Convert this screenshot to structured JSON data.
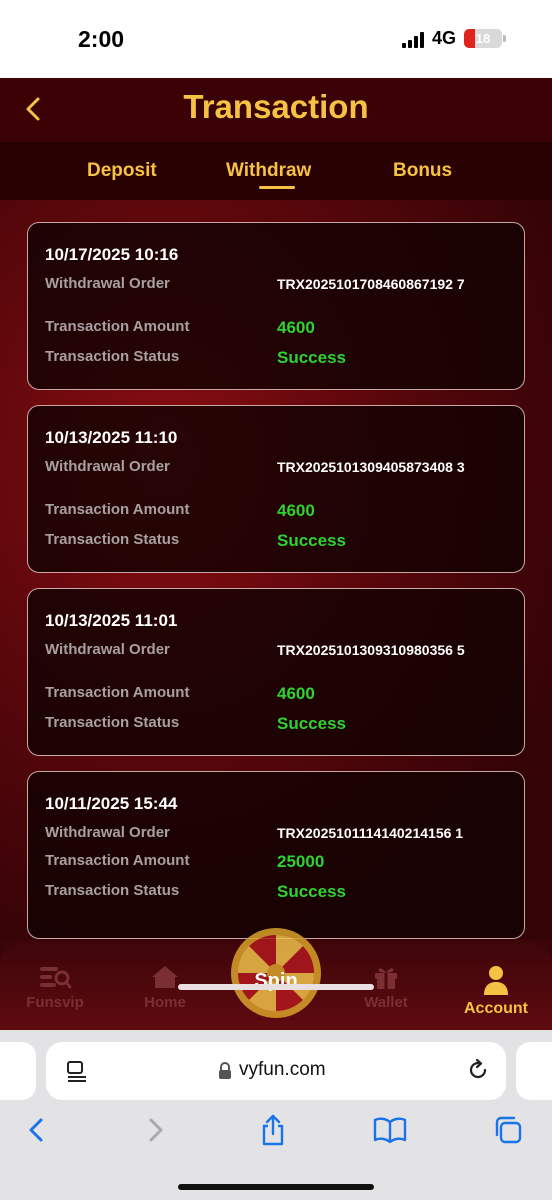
{
  "status_bar": {
    "time": "2:00",
    "network": "4G",
    "battery_level": "18",
    "battery_color": "#e0241b"
  },
  "header": {
    "title": "Transaction",
    "back_icon": "chevron-left-icon",
    "accent_color": "#f6c244"
  },
  "tabs": {
    "items": [
      "Deposit",
      "Withdraw",
      "Bonus"
    ],
    "active": "Withdraw"
  },
  "transactions": [
    {
      "datetime": "10/17/2025 10:16",
      "order_label": "Withdrawal Order",
      "order_id": "TRX2025101708460867192 7",
      "amount_label": "Transaction Amount",
      "amount": "4600",
      "status_label": "Transaction Status",
      "status": "Success"
    },
    {
      "datetime": "10/13/2025 11:10",
      "order_label": "Withdrawal Order",
      "order_id": "TRX2025101309405873408 3",
      "amount_label": "Transaction Amount",
      "amount": "4600",
      "status_label": "Transaction Status",
      "status": "Success"
    },
    {
      "datetime": "10/13/2025 11:01",
      "order_label": "Withdrawal Order",
      "order_id": "TRX2025101309310980356 5",
      "amount_label": "Transaction Amount",
      "amount": "4600",
      "status_label": "Transaction Status",
      "status": "Success"
    },
    {
      "datetime": "10/11/2025 15:44",
      "order_label": "Withdrawal Order",
      "order_id": "TRX2025101114140214156 1",
      "amount_label": "Transaction Amount",
      "amount": "25000",
      "status_label": "Transaction Status",
      "status": "Success"
    }
  ],
  "success_color": "#2fd22f",
  "bottom_nav": {
    "items": [
      {
        "label": "Funsvip",
        "icon": "funsvip-icon"
      },
      {
        "label": "Home",
        "icon": "home-icon"
      },
      {
        "label": "Spin",
        "icon": "spin-wheel-icon"
      },
      {
        "label": "Wallet",
        "icon": "gift-icon"
      },
      {
        "label": "Account",
        "icon": "person-icon"
      }
    ],
    "active": "Account"
  },
  "browser": {
    "url": "vyfun.com",
    "icons": [
      "reader-icon",
      "lock-icon",
      "reload-icon",
      "back-arrow-icon",
      "forward-arrow-icon",
      "share-icon",
      "bookmarks-icon",
      "tabs-icon"
    ]
  }
}
